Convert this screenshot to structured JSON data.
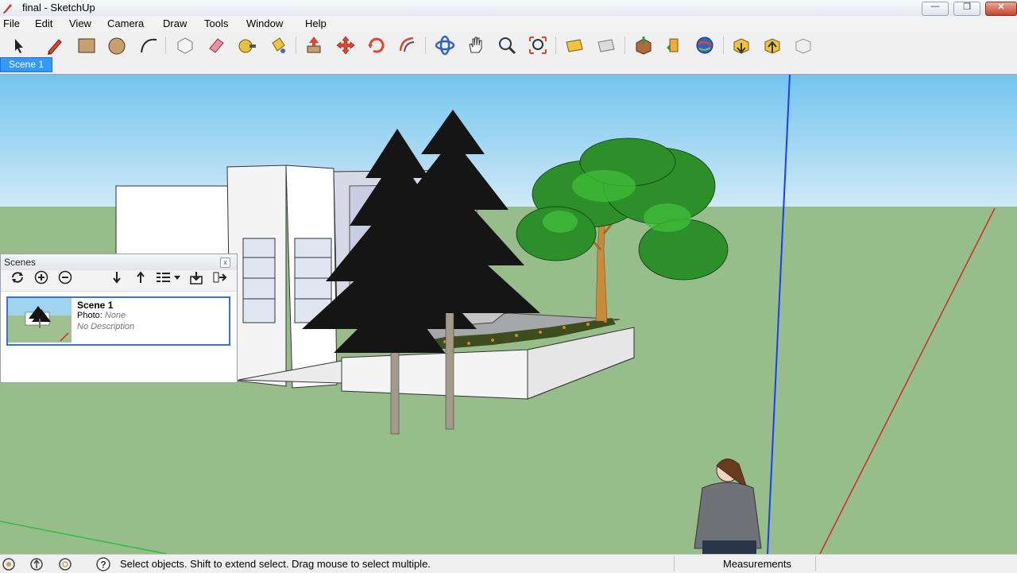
{
  "window": {
    "title": "final - SketchUp",
    "min_glyph": "—",
    "max_glyph": "❐",
    "close_glyph": "✕"
  },
  "menu": [
    "File",
    "Edit",
    "View",
    "Camera",
    "Draw",
    "Tools",
    "Window",
    "Help"
  ],
  "toolbar": {
    "tools": [
      "select",
      "pencil",
      "rectangle",
      "circle",
      "arc",
      "make-component",
      "eraser",
      "tape-measure",
      "paint-bucket",
      "push-pull",
      "move",
      "rotate",
      "offset",
      "orbit",
      "pan",
      "zoom",
      "zoom-extents",
      "previous-view",
      "next-view",
      "add-location",
      "toggle-terrain",
      "get-models",
      "share-model",
      "get-components",
      "share-component",
      "preview-in-google-earth"
    ]
  },
  "scene_tabs": [
    "Scene 1"
  ],
  "scenes_panel": {
    "title": "Scenes",
    "close_glyph": "x",
    "scene": {
      "name": "Scene 1",
      "photo_label": "Photo:",
      "photo_value": "None",
      "description": "No Description"
    }
  },
  "status": {
    "message": "Select objects. Shift to extend select. Drag mouse to select multiple.",
    "measurements_label": "Measurements"
  },
  "colors": {
    "sky_top": "#73c4ef",
    "sky_horizon": "#cfe9f7",
    "ground": "#97bd8b",
    "selection_blue": "#3399ff",
    "axis_blue": "#1a3cff",
    "axis_red": "#d62a1e",
    "axis_green": "#2fbf3a"
  }
}
